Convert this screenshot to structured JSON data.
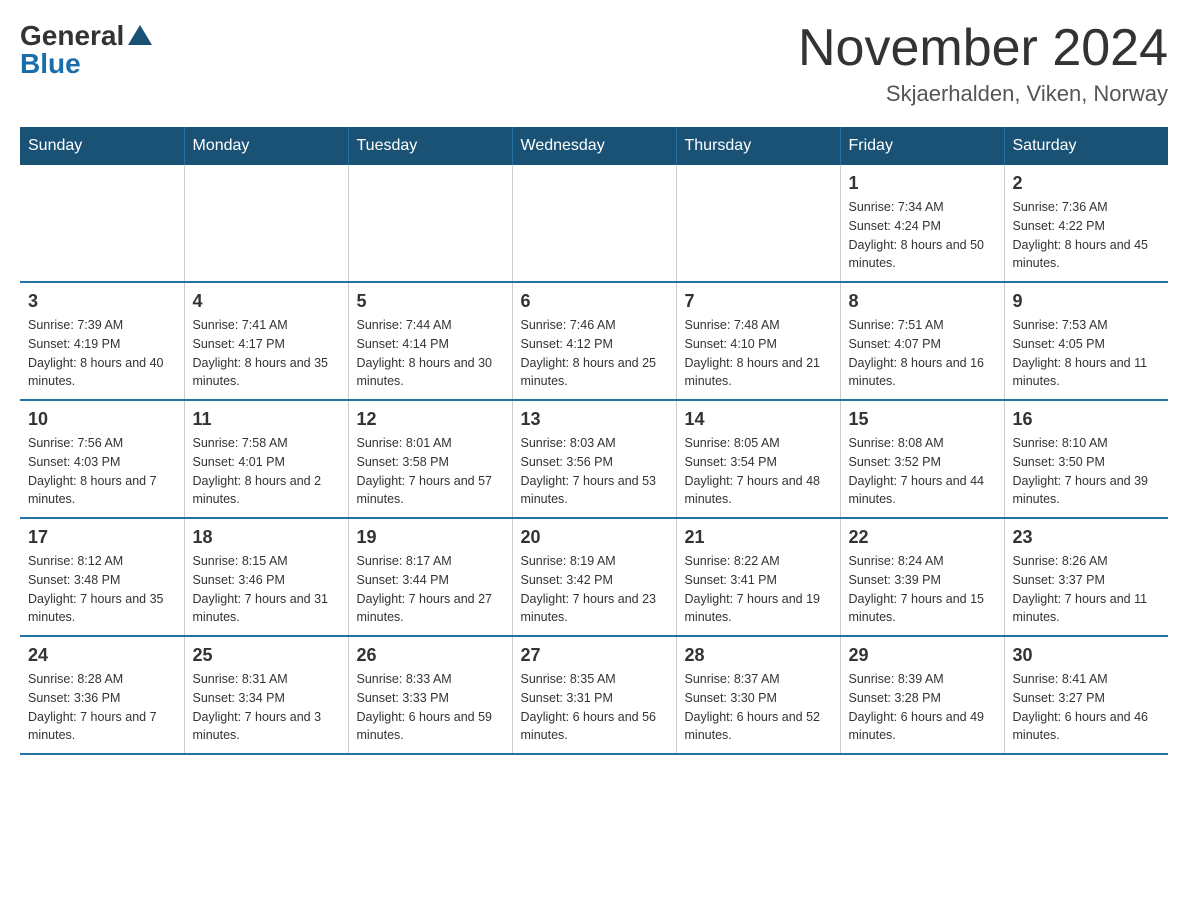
{
  "header": {
    "logo_general": "General",
    "logo_blue": "Blue",
    "month_title": "November 2024",
    "location": "Skjaerhalden, Viken, Norway"
  },
  "weekdays": [
    "Sunday",
    "Monday",
    "Tuesday",
    "Wednesday",
    "Thursday",
    "Friday",
    "Saturday"
  ],
  "weeks": [
    [
      {
        "day": "",
        "sunrise": "",
        "sunset": "",
        "daylight": ""
      },
      {
        "day": "",
        "sunrise": "",
        "sunset": "",
        "daylight": ""
      },
      {
        "day": "",
        "sunrise": "",
        "sunset": "",
        "daylight": ""
      },
      {
        "day": "",
        "sunrise": "",
        "sunset": "",
        "daylight": ""
      },
      {
        "day": "",
        "sunrise": "",
        "sunset": "",
        "daylight": ""
      },
      {
        "day": "1",
        "sunrise": "Sunrise: 7:34 AM",
        "sunset": "Sunset: 4:24 PM",
        "daylight": "Daylight: 8 hours and 50 minutes."
      },
      {
        "day": "2",
        "sunrise": "Sunrise: 7:36 AM",
        "sunset": "Sunset: 4:22 PM",
        "daylight": "Daylight: 8 hours and 45 minutes."
      }
    ],
    [
      {
        "day": "3",
        "sunrise": "Sunrise: 7:39 AM",
        "sunset": "Sunset: 4:19 PM",
        "daylight": "Daylight: 8 hours and 40 minutes."
      },
      {
        "day": "4",
        "sunrise": "Sunrise: 7:41 AM",
        "sunset": "Sunset: 4:17 PM",
        "daylight": "Daylight: 8 hours and 35 minutes."
      },
      {
        "day": "5",
        "sunrise": "Sunrise: 7:44 AM",
        "sunset": "Sunset: 4:14 PM",
        "daylight": "Daylight: 8 hours and 30 minutes."
      },
      {
        "day": "6",
        "sunrise": "Sunrise: 7:46 AM",
        "sunset": "Sunset: 4:12 PM",
        "daylight": "Daylight: 8 hours and 25 minutes."
      },
      {
        "day": "7",
        "sunrise": "Sunrise: 7:48 AM",
        "sunset": "Sunset: 4:10 PM",
        "daylight": "Daylight: 8 hours and 21 minutes."
      },
      {
        "day": "8",
        "sunrise": "Sunrise: 7:51 AM",
        "sunset": "Sunset: 4:07 PM",
        "daylight": "Daylight: 8 hours and 16 minutes."
      },
      {
        "day": "9",
        "sunrise": "Sunrise: 7:53 AM",
        "sunset": "Sunset: 4:05 PM",
        "daylight": "Daylight: 8 hours and 11 minutes."
      }
    ],
    [
      {
        "day": "10",
        "sunrise": "Sunrise: 7:56 AM",
        "sunset": "Sunset: 4:03 PM",
        "daylight": "Daylight: 8 hours and 7 minutes."
      },
      {
        "day": "11",
        "sunrise": "Sunrise: 7:58 AM",
        "sunset": "Sunset: 4:01 PM",
        "daylight": "Daylight: 8 hours and 2 minutes."
      },
      {
        "day": "12",
        "sunrise": "Sunrise: 8:01 AM",
        "sunset": "Sunset: 3:58 PM",
        "daylight": "Daylight: 7 hours and 57 minutes."
      },
      {
        "day": "13",
        "sunrise": "Sunrise: 8:03 AM",
        "sunset": "Sunset: 3:56 PM",
        "daylight": "Daylight: 7 hours and 53 minutes."
      },
      {
        "day": "14",
        "sunrise": "Sunrise: 8:05 AM",
        "sunset": "Sunset: 3:54 PM",
        "daylight": "Daylight: 7 hours and 48 minutes."
      },
      {
        "day": "15",
        "sunrise": "Sunrise: 8:08 AM",
        "sunset": "Sunset: 3:52 PM",
        "daylight": "Daylight: 7 hours and 44 minutes."
      },
      {
        "day": "16",
        "sunrise": "Sunrise: 8:10 AM",
        "sunset": "Sunset: 3:50 PM",
        "daylight": "Daylight: 7 hours and 39 minutes."
      }
    ],
    [
      {
        "day": "17",
        "sunrise": "Sunrise: 8:12 AM",
        "sunset": "Sunset: 3:48 PM",
        "daylight": "Daylight: 7 hours and 35 minutes."
      },
      {
        "day": "18",
        "sunrise": "Sunrise: 8:15 AM",
        "sunset": "Sunset: 3:46 PM",
        "daylight": "Daylight: 7 hours and 31 minutes."
      },
      {
        "day": "19",
        "sunrise": "Sunrise: 8:17 AM",
        "sunset": "Sunset: 3:44 PM",
        "daylight": "Daylight: 7 hours and 27 minutes."
      },
      {
        "day": "20",
        "sunrise": "Sunrise: 8:19 AM",
        "sunset": "Sunset: 3:42 PM",
        "daylight": "Daylight: 7 hours and 23 minutes."
      },
      {
        "day": "21",
        "sunrise": "Sunrise: 8:22 AM",
        "sunset": "Sunset: 3:41 PM",
        "daylight": "Daylight: 7 hours and 19 minutes."
      },
      {
        "day": "22",
        "sunrise": "Sunrise: 8:24 AM",
        "sunset": "Sunset: 3:39 PM",
        "daylight": "Daylight: 7 hours and 15 minutes."
      },
      {
        "day": "23",
        "sunrise": "Sunrise: 8:26 AM",
        "sunset": "Sunset: 3:37 PM",
        "daylight": "Daylight: 7 hours and 11 minutes."
      }
    ],
    [
      {
        "day": "24",
        "sunrise": "Sunrise: 8:28 AM",
        "sunset": "Sunset: 3:36 PM",
        "daylight": "Daylight: 7 hours and 7 minutes."
      },
      {
        "day": "25",
        "sunrise": "Sunrise: 8:31 AM",
        "sunset": "Sunset: 3:34 PM",
        "daylight": "Daylight: 7 hours and 3 minutes."
      },
      {
        "day": "26",
        "sunrise": "Sunrise: 8:33 AM",
        "sunset": "Sunset: 3:33 PM",
        "daylight": "Daylight: 6 hours and 59 minutes."
      },
      {
        "day": "27",
        "sunrise": "Sunrise: 8:35 AM",
        "sunset": "Sunset: 3:31 PM",
        "daylight": "Daylight: 6 hours and 56 minutes."
      },
      {
        "day": "28",
        "sunrise": "Sunrise: 8:37 AM",
        "sunset": "Sunset: 3:30 PM",
        "daylight": "Daylight: 6 hours and 52 minutes."
      },
      {
        "day": "29",
        "sunrise": "Sunrise: 8:39 AM",
        "sunset": "Sunset: 3:28 PM",
        "daylight": "Daylight: 6 hours and 49 minutes."
      },
      {
        "day": "30",
        "sunrise": "Sunrise: 8:41 AM",
        "sunset": "Sunset: 3:27 PM",
        "daylight": "Daylight: 6 hours and 46 minutes."
      }
    ]
  ]
}
